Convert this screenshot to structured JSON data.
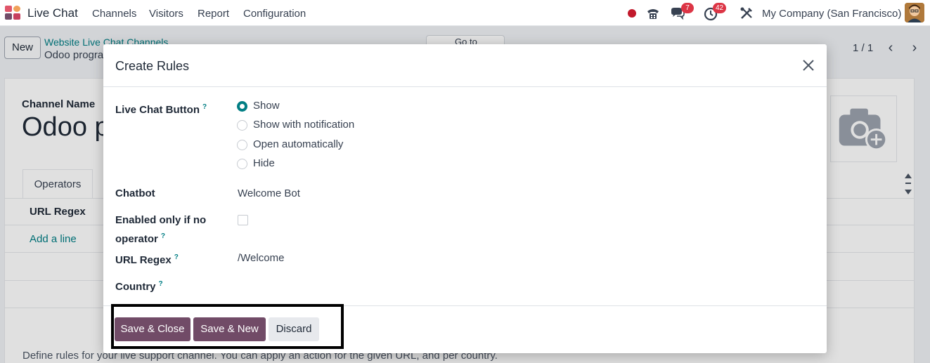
{
  "navbar": {
    "app_name": "Live Chat",
    "menu": [
      "Channels",
      "Visitors",
      "Report",
      "Configuration"
    ],
    "chat_badge": "7",
    "activity_badge": "42",
    "company": "My Company (San Francisco)"
  },
  "control_panel": {
    "new_label": "New",
    "breadcrumb": "Website Live Chat Channels",
    "record_name": "Odoo progra",
    "goto_label": "Go to",
    "pager": "1 / 1"
  },
  "form": {
    "channel_name_label": "Channel Name",
    "channel_name": "Odoo p",
    "tab_operators": "Operators",
    "rules_column": "URL Regex",
    "add_line": "Add a line",
    "help_text": "Define rules for your live support channel. You can apply an action for the given URL, and per country."
  },
  "modal": {
    "title": "Create Rules",
    "fields": {
      "live_chat_button_label": "Live Chat Button",
      "live_chat_button_options": [
        "Show",
        "Show with notification",
        "Open automatically",
        "Hide"
      ],
      "live_chat_button_selected": "Show",
      "chatbot_label": "Chatbot",
      "chatbot_value": "Welcome Bot",
      "enabled_label_line1": "Enabled only if no",
      "enabled_label_line2": "operator",
      "enabled_value": false,
      "url_regex_label": "URL Regex",
      "url_regex_value": "/Welcome",
      "country_label": "Country",
      "help_mark": "?"
    },
    "buttons": {
      "save_close": "Save & Close",
      "save_new": "Save & New",
      "discard": "Discard"
    }
  },
  "colors": {
    "brand": "#714b67",
    "accent": "#017e84",
    "badge": "#dc3545"
  }
}
